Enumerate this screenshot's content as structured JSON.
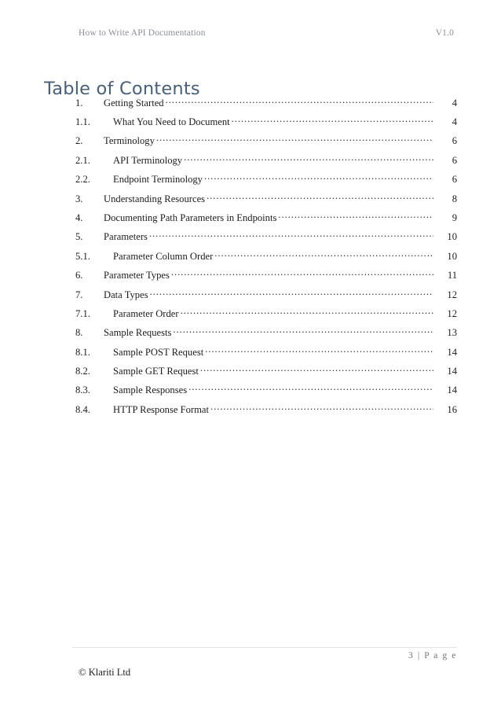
{
  "header": {
    "title": "How to Write API Documentation",
    "version": "V1.0"
  },
  "toc": {
    "heading": "Table of Contents",
    "entries": [
      {
        "number": "1.",
        "label": "Getting Started",
        "page": "4",
        "level": 1
      },
      {
        "number": "1.1.",
        "label": "What You Need to Document",
        "page": "4",
        "level": 2
      },
      {
        "number": "2.",
        "label": "Terminology",
        "page": "6",
        "level": 1
      },
      {
        "number": "2.1.",
        "label": "API Terminology",
        "page": "6",
        "level": 2
      },
      {
        "number": "2.2.",
        "label": "Endpoint Terminology",
        "page": "6",
        "level": 2
      },
      {
        "number": "3.",
        "label": "Understanding Resources",
        "page": "8",
        "level": 1
      },
      {
        "number": "4.",
        "label": "Documenting Path Parameters in Endpoints",
        "page": "9",
        "level": 1
      },
      {
        "number": "5.",
        "label": "Parameters",
        "page": "10",
        "level": 1
      },
      {
        "number": "5.1.",
        "label": "Parameter Column Order",
        "page": "10",
        "level": 2
      },
      {
        "number": "6.",
        "label": "Parameter Types",
        "page": "11",
        "level": 1
      },
      {
        "number": "7.",
        "label": "Data Types",
        "page": "12",
        "level": 1
      },
      {
        "number": "7.1.",
        "label": "Parameter Order",
        "page": "12",
        "level": 2
      },
      {
        "number": "8.",
        "label": "Sample Requests",
        "page": "13",
        "level": 1
      },
      {
        "number": "8.1.",
        "label": "Sample POST Request",
        "page": "14",
        "level": 2
      },
      {
        "number": "8.2.",
        "label": "Sample GET Request",
        "page": "14",
        "level": 2
      },
      {
        "number": "8.3.",
        "label": "Sample Responses",
        "page": "14",
        "level": 2
      },
      {
        "number": "8.4.",
        "label": "HTTP Response Format",
        "page": "16",
        "level": 2
      }
    ]
  },
  "footer": {
    "page_label": "3 | P a g e",
    "copyright": "© Klariti Ltd"
  },
  "colors": {
    "heading": "#45617c",
    "header_text": "#8a8f96",
    "body_text": "#1c1c1c",
    "rule": "#e3e3e6"
  }
}
